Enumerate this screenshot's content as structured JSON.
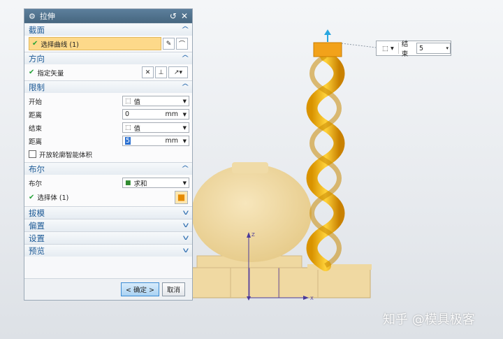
{
  "dialog": {
    "title": "拉伸",
    "title_icon": "gear-icon",
    "sections": {
      "section": {
        "title": "截面",
        "select_curve": "选择曲线 (1)"
      },
      "direction": {
        "title": "方向",
        "specify_vector": "指定矢量"
      },
      "limits": {
        "title": "限制",
        "start_label": "开始",
        "start_value": "值",
        "distance1_label": "距离",
        "distance1_value": "0",
        "distance1_unit": "mm",
        "end_label": "结束",
        "end_value": "值",
        "distance2_label": "距离",
        "distance2_value": "5",
        "distance2_unit": "mm",
        "open_profile": "开放轮廓智能体积"
      },
      "boolean": {
        "title": "布尔",
        "boolean_label": "布尔",
        "boolean_value": "求和",
        "select_body": "选择体 (1)"
      },
      "draft": {
        "title": "拔模"
      },
      "offset": {
        "title": "偏置"
      },
      "settings": {
        "title": "设置"
      },
      "preview": {
        "title": "预览"
      }
    },
    "ok_label": "< 确定 >",
    "cancel_label": "取消"
  },
  "mini_toolbar": {
    "end_label": "结束",
    "end_value": "5"
  },
  "watermark": "知乎 @模具极客",
  "colors": {
    "accent": "#1d5a96",
    "highlight": "#fdd98a",
    "part": "#f1d89b",
    "spring": "#f2b40a"
  }
}
